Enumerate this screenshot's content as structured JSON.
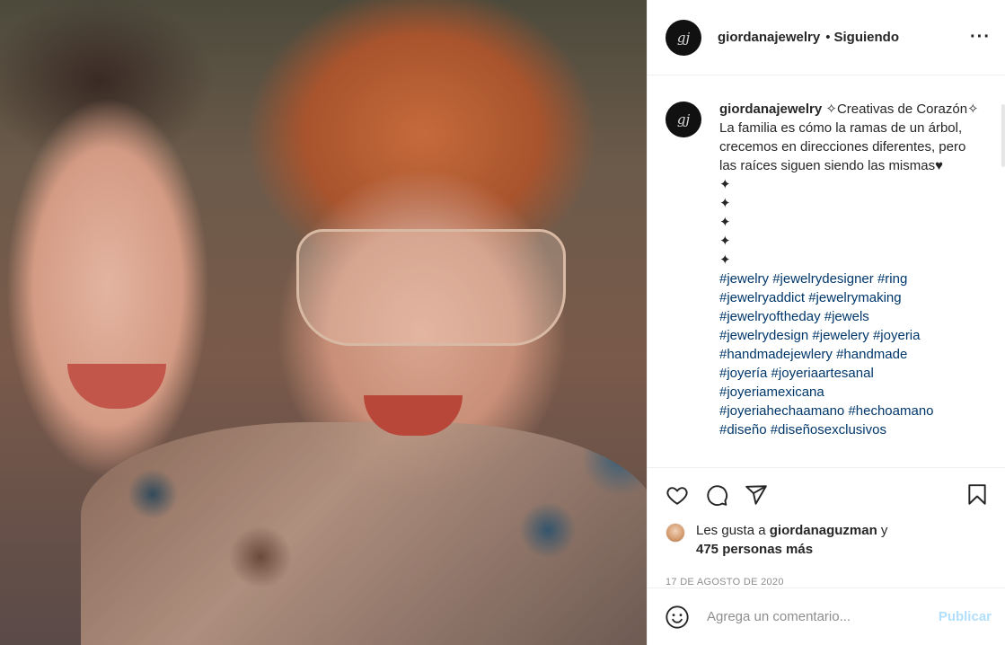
{
  "post": {
    "account": {
      "username": "giordanajewelry",
      "dot": "•",
      "follow_status": "Siguiendo",
      "more": "···"
    },
    "caption": {
      "username": "giordanajewelry",
      "text": "✧Creativas de Corazón✧ La familia es cómo la ramas de un árbol, crecemos en direcciones diferentes, pero las raíces siguen siendo las mismas♥",
      "sparkles": [
        "✦",
        "✦",
        "✦",
        "✦",
        "✦"
      ],
      "hashtag_lines": [
        [
          "#jewelry",
          "#jewelrydesigner",
          "#ring"
        ],
        [
          "#jewelryaddict",
          "#jewelrymaking"
        ],
        [
          "#jewelryoftheday",
          "#jewels"
        ],
        [
          "#jewelrydesign",
          "#jewelery",
          "#joyeria"
        ],
        [
          "#handmadejewlery",
          "#handmade"
        ],
        [
          "#joyería",
          "#joyeriaartesanal"
        ],
        [
          "#joyeriamexicana"
        ],
        [
          "#joyeriahechaamano",
          "#hechoamano"
        ],
        [
          "#diseño",
          "#diseñosexclusivos"
        ]
      ]
    },
    "likes": {
      "prefix": "Les gusta a ",
      "user": "giordanaguzman",
      "suffix": " y",
      "others": "475 personas más"
    },
    "date": "17 DE AGOSTO DE 2020",
    "comment_box": {
      "placeholder": "Agrega un comentario...",
      "publish_label": "Publicar"
    },
    "icons": {
      "like": "heart-icon",
      "comment": "comment-icon",
      "share": "share-icon",
      "save": "bookmark-icon",
      "emoji": "emoji-icon"
    },
    "colors": {
      "hashtag": "#00376b",
      "publish_disabled": "#b2dffc",
      "meta_gray": "#8e8e8e"
    }
  }
}
